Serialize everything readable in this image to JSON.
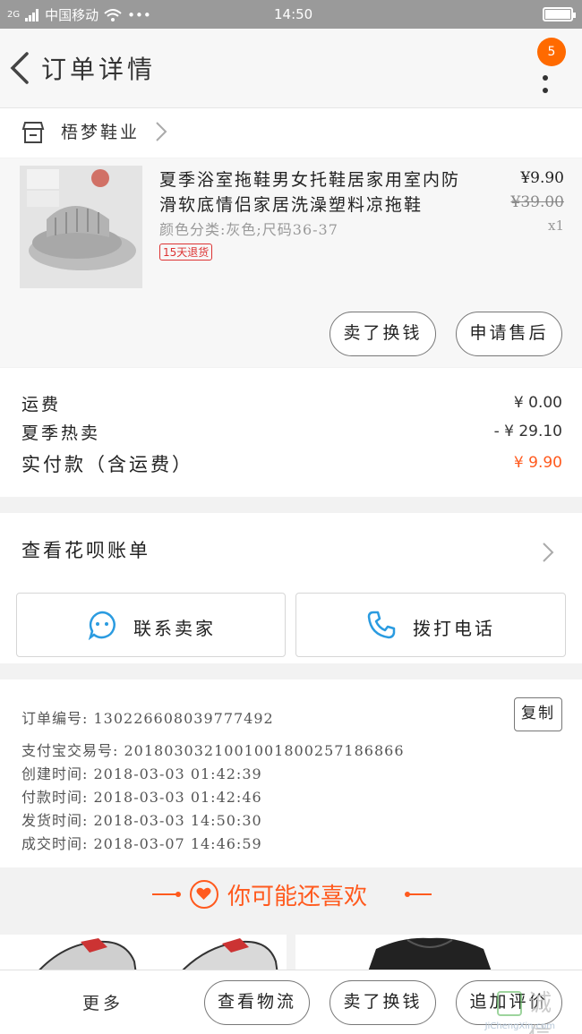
{
  "status_bar": {
    "signal_text": "2G",
    "carrier": "中国移动",
    "dots": "•••",
    "time": "14:50"
  },
  "header": {
    "title": "订单详情",
    "notification_badge": "5",
    "back_icon": "chevron-left-icon",
    "menu_icon": "more-vertical-icon"
  },
  "shop": {
    "name": "梧梦鞋业",
    "icon": "store-icon"
  },
  "product": {
    "title_line1": "夏季浴室拖鞋男女托鞋居家用室内防",
    "title_line2": "滑软底情侣家居洗澡塑料凉拖鞋",
    "sku": "颜色分类:灰色;尺码36-37",
    "tag": "15天退货",
    "price": "¥9.90",
    "original_price": "¥39.00",
    "quantity": "x1",
    "buttons": [
      "卖了换钱",
      "申请售后"
    ]
  },
  "fees": [
    {
      "label": "运费",
      "value": "¥ 0.00"
    },
    {
      "label": "夏季热卖",
      "value": "- ¥ 29.10"
    },
    {
      "label": "实付款（含运费）",
      "value": "¥ 9.90"
    }
  ],
  "huabei": {
    "label": "查看花呗账单",
    "contact_seller": "联系卖家",
    "call_phone": "拨打电话"
  },
  "order_info": {
    "order_no": "订单编号: 130226608039777492",
    "copy_label": "复制",
    "alipay_no": "支付宝交易号: 2018030321001001800257186866",
    "created": "创建时间: 2018-03-03 01:42:39",
    "paid": "付款时间: 2018-03-03 01:42:46",
    "shipped": "发货时间: 2018-03-03 14:50:30",
    "completed": "成交时间: 2018-03-07 14:46:59"
  },
  "recommend": {
    "title": "你可能还喜欢"
  },
  "bottom_bar": {
    "more": "更多",
    "buttons": [
      "查看物流",
      "卖了换钱",
      "追加评价"
    ]
  },
  "watermark": {
    "text": "诚信",
    "url": "JiChengXin.com"
  },
  "colors": {
    "accent": "#ff5a1e",
    "badge": "#ff6a00",
    "link_blue": "#2a9be0",
    "tag_red": "#dd3333"
  }
}
